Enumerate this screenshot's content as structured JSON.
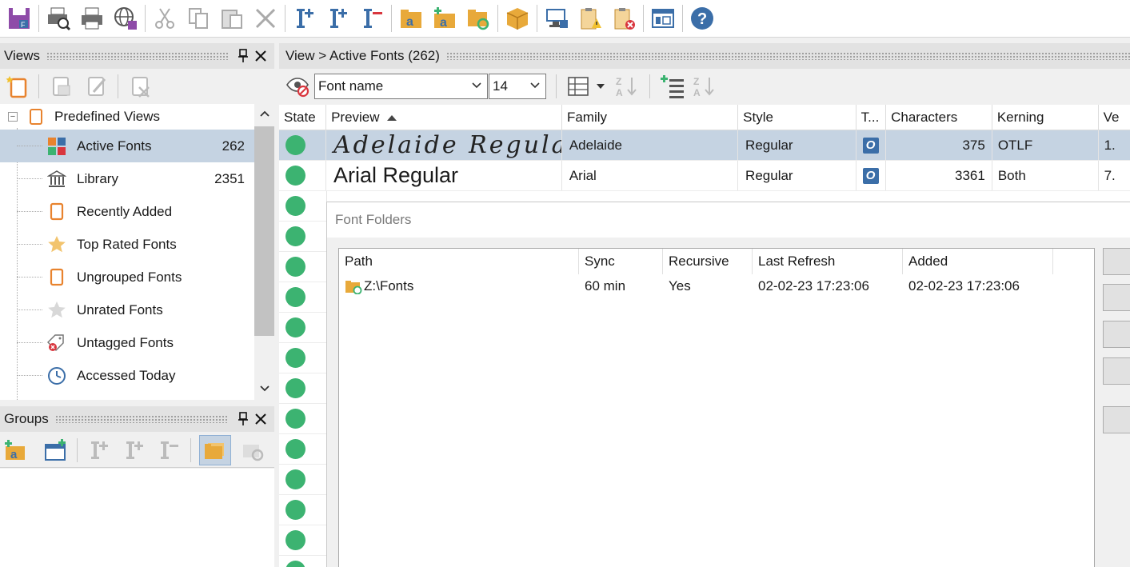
{
  "toolbar": {
    "icons": [
      "save-icon",
      "print-preview-icon",
      "print-icon",
      "web-icon",
      "cut-icon",
      "copy-icon",
      "paste-icon",
      "delete-icon",
      "install-font-icon",
      "add-font-icon",
      "remove-font-icon",
      "group-font-icon",
      "add-group-icon",
      "refresh-folder-icon",
      "package-icon",
      "network-settings-icon",
      "warning-clipboard-icon",
      "error-clipboard-icon",
      "layout-icon",
      "help-icon"
    ]
  },
  "views_pane": {
    "title": "Views",
    "pin": "📌",
    "close": "✕",
    "root_label": "Predefined Views",
    "root_expander": "−",
    "items": [
      {
        "label": "Active Fonts",
        "count": "262",
        "icon": "grid-color-icon"
      },
      {
        "label": "Library",
        "count": "2351",
        "icon": "library-icon"
      },
      {
        "label": "Recently Added",
        "count": "",
        "icon": "view-icon"
      },
      {
        "label": "Top Rated Fonts",
        "count": "",
        "icon": "star-icon"
      },
      {
        "label": "Ungrouped Fonts",
        "count": "",
        "icon": "view-icon"
      },
      {
        "label": "Unrated Fonts",
        "count": "",
        "icon": "star-grey-icon"
      },
      {
        "label": "Untagged Fonts",
        "count": "",
        "icon": "tag-icon"
      },
      {
        "label": "Accessed Today",
        "count": "",
        "icon": "clock-icon"
      }
    ]
  },
  "groups_pane": {
    "title": "Groups",
    "pin": "📌",
    "close": "✕"
  },
  "main": {
    "breadcrumb": "View > Active Fonts (262)",
    "filter_field": "Font name",
    "size_field": "14",
    "columns": [
      "State",
      "Preview",
      "Family",
      "Style",
      "T...",
      "Characters",
      "Kerning",
      "Ve"
    ],
    "rows": [
      {
        "preview": "Adelaide Regular",
        "family": "Adelaide",
        "style": "Regular",
        "type": "O",
        "characters": "375",
        "kerning": "OTLF",
        "version": "1."
      },
      {
        "preview": "Arial Regular",
        "family": "Arial",
        "style": "Regular",
        "type": "O",
        "characters": "3361",
        "kerning": "Both",
        "version": "7."
      }
    ]
  },
  "dialog": {
    "title": "Font Folders",
    "columns": [
      "Path",
      "Sync",
      "Recursive",
      "Last Refresh",
      "Added"
    ],
    "rows": [
      {
        "path": "Z:\\Fonts",
        "sync": "60 min",
        "recursive": "Yes",
        "last_refresh": "02-02-23 17:23:06",
        "added": "02-02-23 17:23:06"
      }
    ]
  }
}
